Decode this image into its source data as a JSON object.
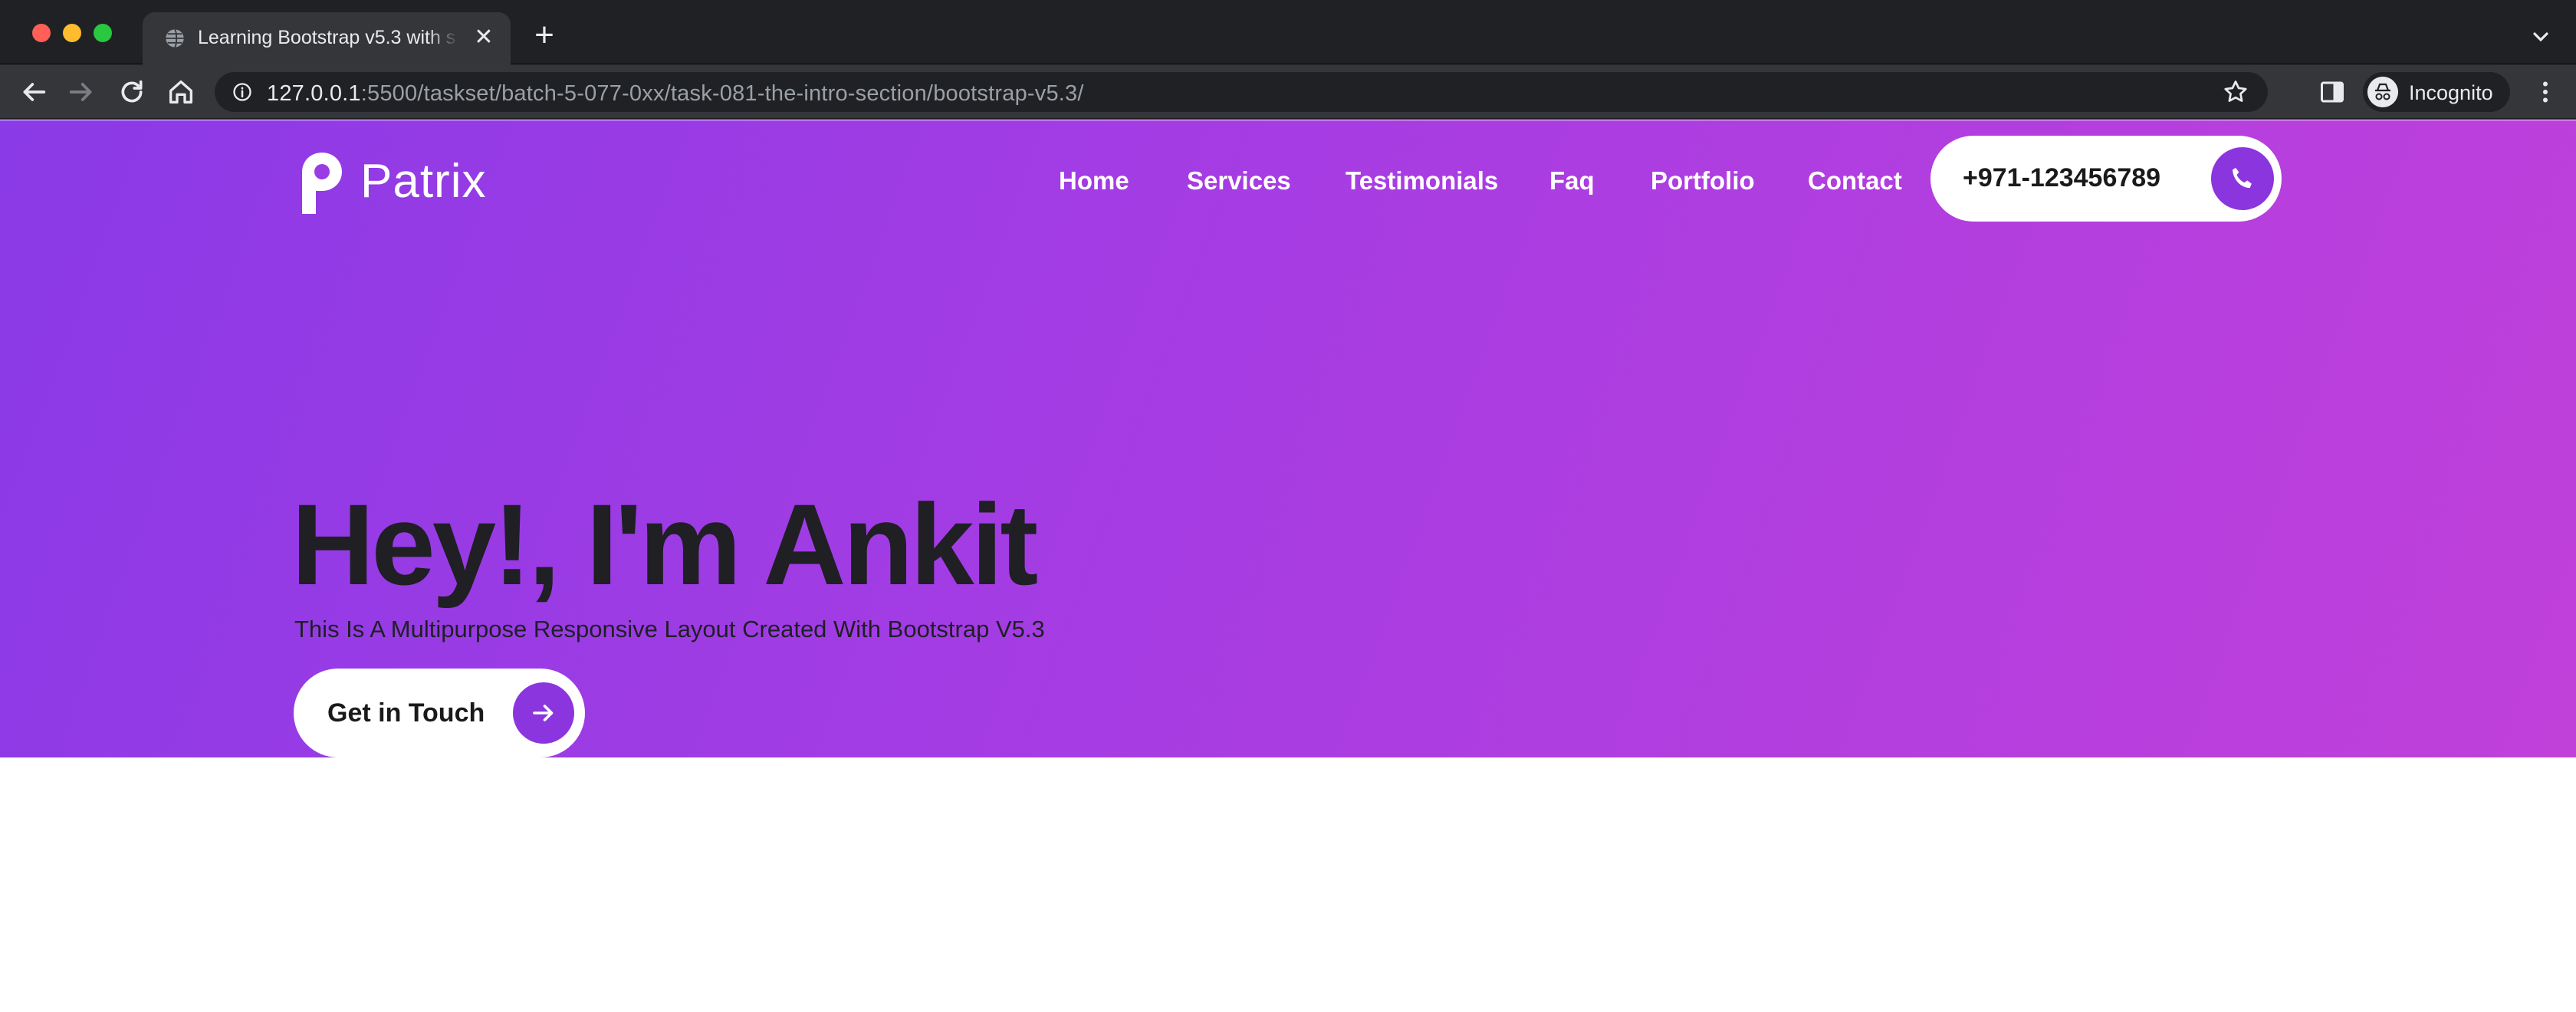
{
  "browser": {
    "tab_title": "Learning Bootstrap v5.3 with s",
    "tab_close": "✕",
    "new_tab": "+",
    "url_host": "127.0.0.1",
    "url_rest": ":5500/taskset/batch-5-077-0xx/task-081-the-intro-section/bootstrap-v5.3/",
    "profile_label": "Incognito"
  },
  "site": {
    "logo_text": "Patrix",
    "nav": [
      "Home",
      "Services",
      "Testimonials",
      "Faq",
      "Portfolio",
      "Contact"
    ],
    "phone": "+971-123456789",
    "accent_color": "#8a35dd"
  },
  "hero": {
    "title": "Hey!, I'm Ankit",
    "subtitle": "This Is A Multipurpose Responsive Layout Created With Bootstrap V5.3",
    "cta_label": "Get in Touch"
  }
}
